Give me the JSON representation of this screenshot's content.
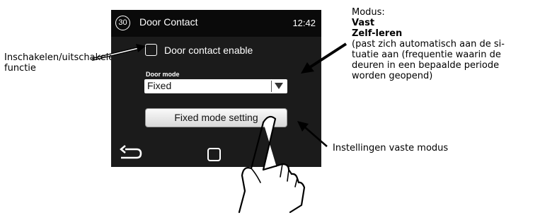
{
  "screen": {
    "number_badge": "30",
    "title": "Door Contact",
    "clock": "12:42",
    "checkbox": {
      "label": "Door contact enable",
      "checked": false
    },
    "door_mode": {
      "label": "Door mode",
      "selected": "Fixed"
    },
    "fixed_mode_button": "Fixed mode setting",
    "nav": {
      "back_icon": "back-arrow-icon",
      "home_icon": "home-square-icon"
    }
  },
  "annotations": {
    "left": {
      "line1": "Inschakelen/uitschakelen",
      "line2": "functie"
    },
    "right": {
      "title": "Modus:",
      "option1": "Vast",
      "option2": "Zelf-leren",
      "desc1": "(past zich automatisch aan de si-",
      "desc2": "tuatie aan (frequentie waarin de",
      "desc3": "deuren in een bepaalde periode",
      "desc4": "worden geopend)"
    },
    "bottom": "Instellingen vaste modus"
  },
  "hand_icon": "pointing-hand-icon"
}
